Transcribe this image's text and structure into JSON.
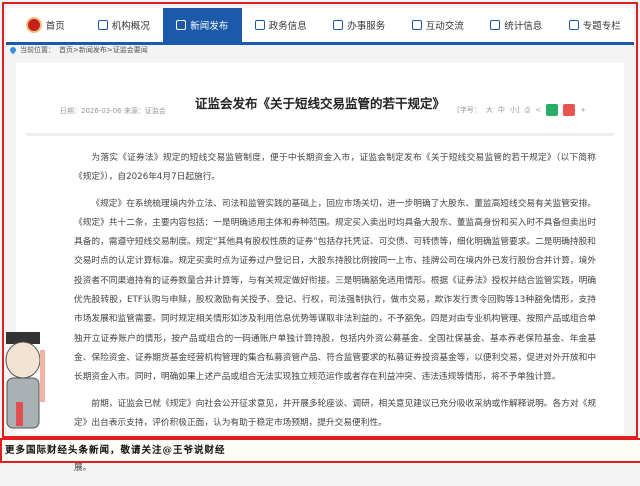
{
  "nav": {
    "items": [
      {
        "label": "首页",
        "icon": "emblem-logo"
      },
      {
        "label": "机构概况",
        "icon": "building-icon"
      },
      {
        "label": "新闻发布",
        "icon": "news-icon",
        "active": true
      },
      {
        "label": "政务信息",
        "icon": "monitor-icon"
      },
      {
        "label": "办事服务",
        "icon": "service-icon"
      },
      {
        "label": "互动交流",
        "icon": "chat-icon"
      },
      {
        "label": "统计信息",
        "icon": "chart-icon"
      },
      {
        "label": "专题专栏",
        "icon": "doc-icon"
      }
    ],
    "accent": "#1a5aa8"
  },
  "breadcrumb": {
    "label": "当前位置：",
    "path": "首页>新闻发布>证监会要闻"
  },
  "article": {
    "title": "证监会发布《关于短线交易监管的若干规定》",
    "meta": "日期：2026-03-06 来源：证监会",
    "font_size_label": "[字号：",
    "sizes": [
      "大",
      "中",
      "小]"
    ],
    "paragraphs": [
      "为落实《证券法》规定的短线交易监管制度，便于中长期资金入市，证监会制定发布《关于短线交易监管的若干规定》（以下简称《规定》），自2026年4月7日起施行。",
      "《规定》在系统梳理境内外立法、司法和监管实践的基础上，回应市场关切，进一步明确了大股东、董监高短线交易有关监管安排。《规定》共十二条，主要内容包括：一是明确适用主体和券种范围。规定买入卖出时均具备大股东、董监高身份和买入时不具备但卖出时具备的，需遵守短线交易制度。规定“其他具有股权性质的证券”包括存托凭证、可交债、可转债等，细化明确监管要求。二是明确持股和交易时点的认定计算标准。规定买卖时点为证券过户登记日，大股东持股比例按同一上市、挂牌公司在境内外已发行股份合并计算，境外投资者不同渠道持有的证券数量合并计算等，与有关规定做好衔接。三是明确豁免适用情形。根据《证券法》授权并结合监管实践，明确优先股转股，ETF认购与申赎，股权激励有关授予、登记、行权，司法强制执行，做市交易，欺诈发行责令回购等13种豁免情形，支持市场发展和监管需要。同时规定相关情形如涉及利用信息优势等谋取非法利益的，不予豁免。四是对由专业机构管理、按照产品或组合单独开立证券账户的情形，按产品或组合的一码通账户单独计算持股，包括内外资公募基金、全国社保基金、基本养老保险基金、年金基金、保险资金、证券期货基金经营机构管理的集合私募资管产品、符合监管要求的私募证券投资基金等，以便利交易，促进对外开放和中长期资金入市。同时，明确如果上述产品或组合无法实现独立规范运作或者存在利益冲突、违法违规等情形，将不予单独计算。",
      "前期，证监会已就《规定》向社会公开征求意见，并开展多轮座谈、调研，相关意见建议已充分吸收采纳或作解释说明。各方对《规定》出台表示支持，评价积极正面，认为有助于稳定市场预期，提升交易便利性。",
      "下一步，证监会将组织证券交易场所等做好《规定》落地实施，持续优化短线交易监管，切实维护市场秩序，推动资本市场高质量发展。"
    ]
  },
  "banner": {
    "text": "更多国际财经头条新闻，敬请关注@王爷说财经"
  }
}
